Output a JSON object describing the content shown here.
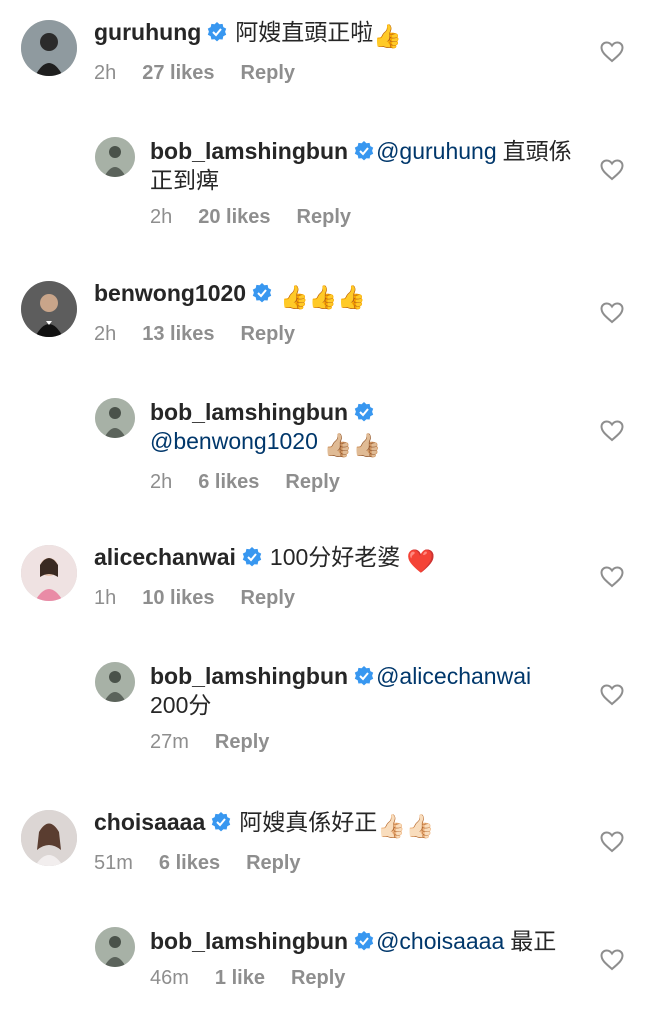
{
  "comments": [
    {
      "user": "guruhung",
      "mention": "",
      "text": "阿嫂直頭正啦",
      "emoji": "👍",
      "time": "2h",
      "likes": "27 likes",
      "reply": "Reply",
      "avatar_color": "#3a3a3a"
    },
    {
      "user": "bob_lamshingbun",
      "mention": "@guruhung",
      "text": "直頭係正到痺",
      "emoji": "",
      "time": "2h",
      "likes": "20 likes",
      "reply": "Reply",
      "avatar_color": "#6b7b6a"
    },
    {
      "user": "benwong1020",
      "mention": "",
      "text": "",
      "emoji": "👍👍👍",
      "time": "2h",
      "likes": "13 likes",
      "reply": "Reply",
      "avatar_color": "#4a4a4a"
    },
    {
      "user": "bob_lamshingbun",
      "mention": "@benwong1020",
      "text": "",
      "emoji": "👍🏼👍🏼",
      "time": "2h",
      "likes": "6 likes",
      "reply": "Reply",
      "avatar_color": "#6b7b6a"
    },
    {
      "user": "alicechanwai",
      "mention": "",
      "text": "100分好老婆",
      "emoji": "❤️",
      "time": "1h",
      "likes": "10 likes",
      "reply": "Reply",
      "avatar_color": "#d8a7a7"
    },
    {
      "user": "bob_lamshingbun",
      "mention": "@alicechanwai",
      "text": "200分",
      "emoji": "",
      "time": "27m",
      "likes": "",
      "reply": "Reply",
      "avatar_color": "#6b7b6a"
    },
    {
      "user": "choisaaaa",
      "mention": "",
      "text": "阿嫂真係好正",
      "emoji": "👍🏻👍🏻",
      "time": "51m",
      "likes": "6 likes",
      "reply": "Reply",
      "avatar_color": "#c9c2c0"
    },
    {
      "user": "bob_lamshingbun",
      "mention": "@choisaaaa",
      "text": "最正",
      "emoji": "",
      "time": "46m",
      "likes": "1 like",
      "reply": "Reply",
      "avatar_color": "#6b7b6a"
    }
  ],
  "colors": {
    "verified": "#3897f0",
    "mention": "#00376b",
    "meta": "#8e8e8e",
    "heart": "#8e8e8e"
  },
  "icons": {
    "verified": "verified-badge-icon",
    "heart": "heart-outline-icon"
  }
}
